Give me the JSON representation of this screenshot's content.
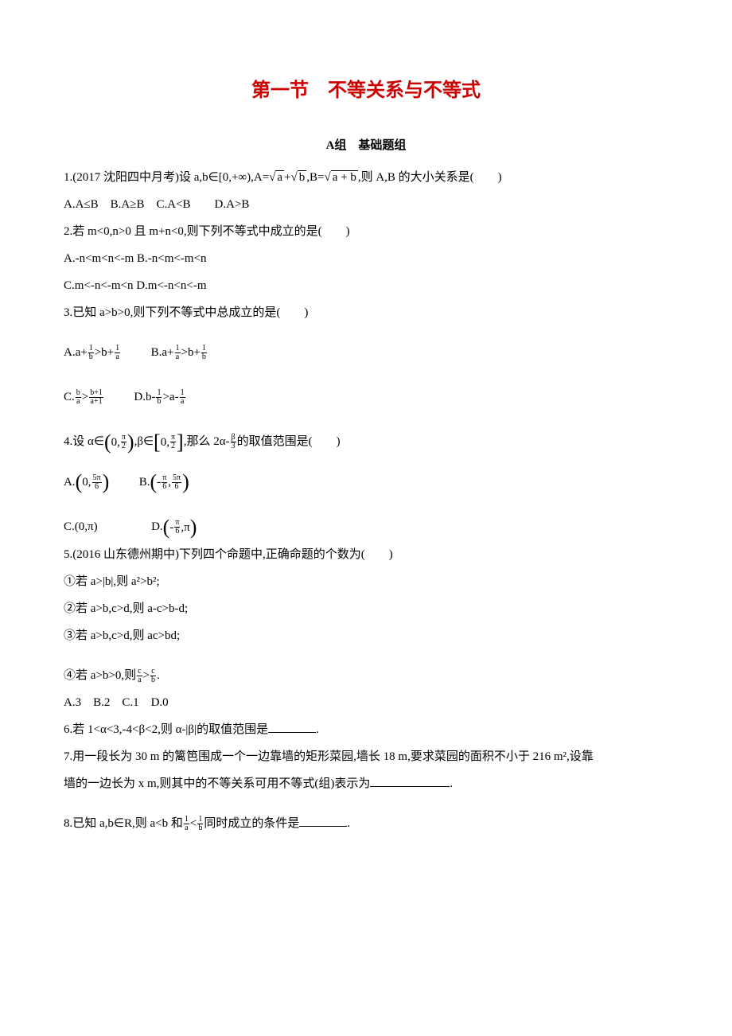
{
  "title": "第一节　不等关系与不等式",
  "subtitle": "A组　基础题组",
  "q1": {
    "stem_before": "1.(2017 沈阳四中月考)设 a,b∈[0,+∞),A=",
    "rad1": "a",
    "plus": "+",
    "rad2": "b",
    "mid": ",B=",
    "rad3": "a + b",
    "tail": ",则 A,B 的大小关系是(　　)",
    "opts": "A.A≤B　B.A≥B　C.A<B　　D.A>B"
  },
  "q2": {
    "stem": "2.若 m<0,n>0 且 m+n<0,则下列不等式中成立的是(　　)",
    "a": "A.-n<m<n<-m",
    "b": "B.-n<m<-m<n",
    "c": "C.m<-n<-m<n",
    "d": "D.m<-n<n<-m"
  },
  "q3": {
    "stem": "3.已知 a>b>0,则下列不等式中总成立的是(　　)",
    "A_pre": "A.a+",
    "A_f1n": "1",
    "A_f1d": "b",
    "A_mid": ">b+",
    "A_f2n": "1",
    "A_f2d": "a",
    "B_pre": "B.a+",
    "B_f1n": "1",
    "B_f1d": "a",
    "B_mid": ">b+",
    "B_f2n": "1",
    "B_f2d": "b",
    "C_pre": "C.",
    "C_f1n": "b",
    "C_f1d": "a",
    "C_mid": ">",
    "C_f2n": "b+1",
    "C_f2d": "a+1",
    "D_pre": "D.b-",
    "D_f1n": "1",
    "D_f1d": "b",
    "D_mid": ">a-",
    "D_f2n": "1",
    "D_f2d": "a"
  },
  "q4": {
    "stem_before": "4.设 α∈",
    "int1_l": "(",
    "int1_a": "0,",
    "int1_bn": "π",
    "int1_bd": "2",
    "int1_r": ")",
    "mid1": ",β∈",
    "int2_l": "[",
    "int2_a": "0,",
    "int2_bn": "π",
    "int2_bd": "2",
    "int2_r": "]",
    "mid2": ",那么 2α-",
    "f3n": "β",
    "f3d": "3",
    "tail": "的取值范围是(　　)",
    "A_pre": "A.",
    "A_l": "(",
    "A_a": "0,",
    "A_bn": "5π",
    "A_bd": "6",
    "A_r": ")",
    "B_pre": "B.",
    "B_l": "(",
    "B_an": "π",
    "B_ad": "6",
    "B_neg": "-",
    "B_sep": ",",
    "B_bn": "5π",
    "B_bd": "6",
    "B_r": ")",
    "C": "C.(0,π)",
    "D_pre": "D.",
    "D_l": "(",
    "D_an": "π",
    "D_ad": "6",
    "D_neg": "-",
    "D_sep": ",π",
    "D_r": ")"
  },
  "q5": {
    "stem": "5.(2016 山东德州期中)下列四个命题中,正确命题的个数为(　　)",
    "p1": "①若 a>|b|,则 a²>b²;",
    "p2": "②若 a>b,c>d,则 a-c>b-d;",
    "p3": "③若 a>b,c>d,则 ac>bd;",
    "p4_pre": "④若 a>b>0,则",
    "p4_f1n": "c",
    "p4_f1d": "a",
    "p4_mid": ">",
    "p4_f2n": "c",
    "p4_f2d": "b",
    "p4_post": ".",
    "opts": "A.3　B.2　C.1　D.0"
  },
  "q6": "6.若 1<α<3,-4<β<2,则 α-|β|的取值范围是",
  "q6_post": ".",
  "q7_l1": "7.用一段长为 30 m 的篱笆围成一个一边靠墙的矩形菜园,墙长 18 m,要求菜园的面积不小于 216 m²,设靠",
  "q7_l2_pre": "墙的一边长为 x m,则其中的不等关系可用不等式(组)表示为",
  "q7_l2_post": ".",
  "q8_pre": "8.已知 a,b∈R,则 a<b 和",
  "q8_f1n": "1",
  "q8_f1d": "a",
  "q8_mid": "<",
  "q8_f2n": "1",
  "q8_f2d": "b",
  "q8_post": "同时成立的条件是",
  "q8_end": "."
}
